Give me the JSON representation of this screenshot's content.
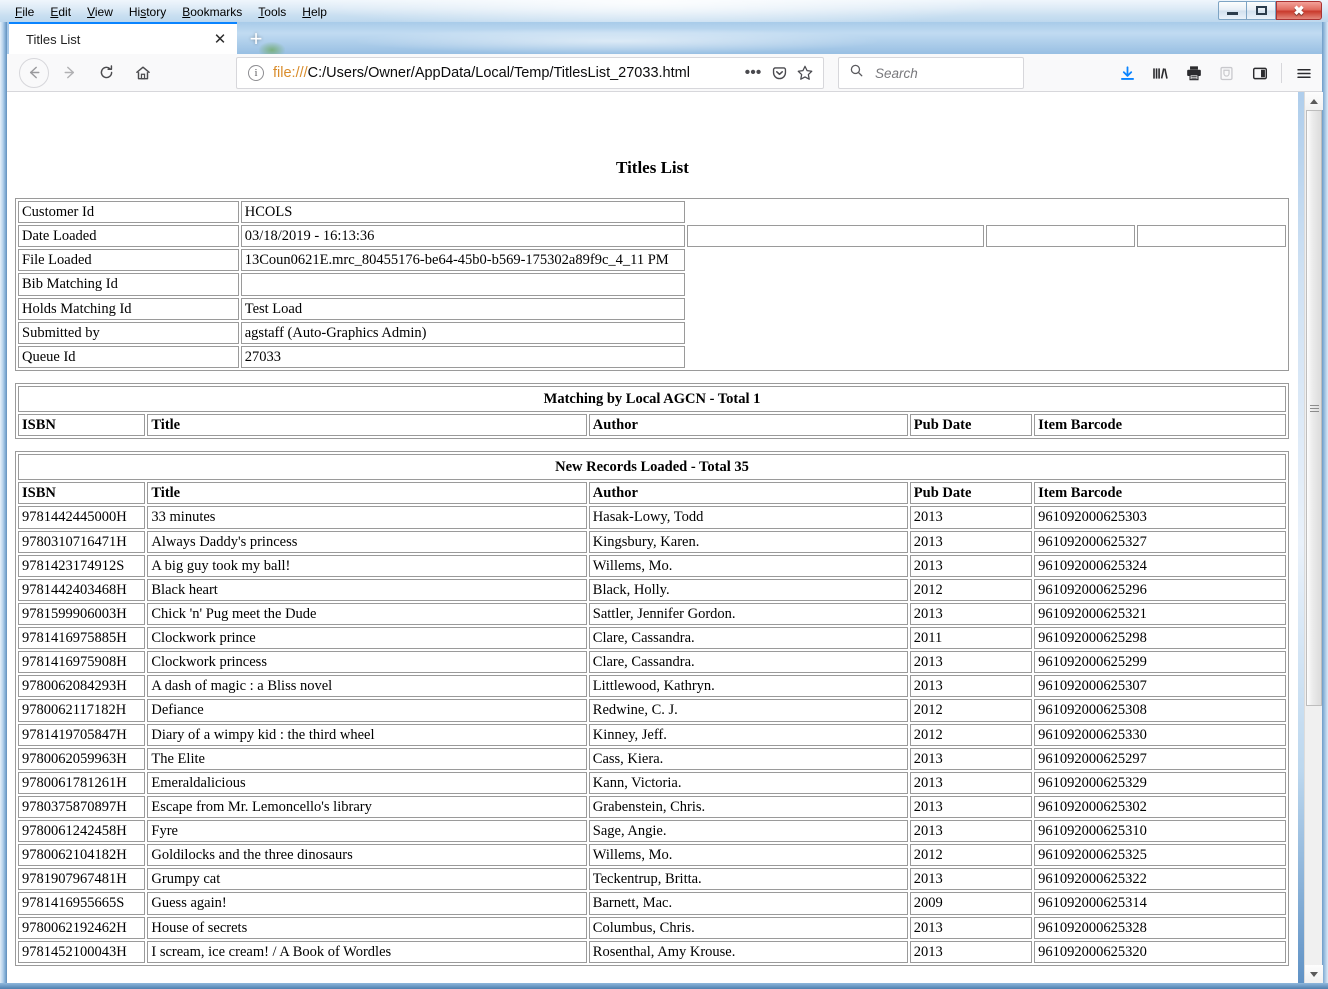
{
  "window": {
    "menu": [
      "File",
      "Edit",
      "View",
      "History",
      "Bookmarks",
      "Tools",
      "Help"
    ],
    "minimize_label": "–",
    "maximize_label": "",
    "close_label": "✕"
  },
  "browser": {
    "tab": {
      "title": "Titles List",
      "close_label": "✕"
    },
    "new_tab_label": "+",
    "url_scheme": "file:///",
    "url_rest": "C:/Users/Owner/AppData/Local/Temp/TitlesList_27033.html",
    "url_full": "file:///C:/Users/Owner/AppData/Local/Temp/TitlesList_27033.html",
    "info_icon_label": "i",
    "page_actions_label": "•••",
    "search": {
      "placeholder": "Search",
      "value": ""
    },
    "toolbar_icons": [
      "download-icon",
      "library-icon",
      "print-icon",
      "shield-icon",
      "sidebar-icon",
      "hamburger-menu-icon"
    ],
    "accent_color": "#0a84ff"
  },
  "page": {
    "title": "Titles List",
    "header": {
      "rows": [
        {
          "label": "Customer Id",
          "value": "HCOLS"
        },
        {
          "label": "Date Loaded",
          "value": "03/18/2019 - 16:13:36"
        },
        {
          "label": "File Loaded",
          "value": "13Coun0621E.mrc_80455176-be64-45b0-b569-175302a89f9c_4_11 PM"
        },
        {
          "label": "Bib Matching Id",
          "value": ""
        },
        {
          "label": "Holds Matching Id",
          "value": "Test Load"
        },
        {
          "label": "Submitted by",
          "value": "agstaff (Auto-Graphics Admin)"
        },
        {
          "label": "Queue Id",
          "value": "27033"
        }
      ],
      "extra_cells": [
        "",
        "",
        ""
      ]
    },
    "columns": [
      "ISBN",
      "Title",
      "Author",
      "Pub Date",
      "Item Barcode"
    ],
    "sections": [
      {
        "heading": "Matching by Local AGCN - Total 1",
        "rows": []
      },
      {
        "heading": "New Records Loaded - Total 35",
        "rows": [
          [
            "9781442445000H",
            "33 minutes",
            "Hasak-Lowy, Todd",
            "2013",
            "961092000625303"
          ],
          [
            "9780310716471H",
            "Always Daddy's princess",
            "Kingsbury, Karen.",
            "2013",
            "961092000625327"
          ],
          [
            "9781423174912S",
            "A big guy took my ball!",
            "Willems, Mo.",
            "2013",
            "961092000625324"
          ],
          [
            "9781442403468H",
            "Black heart",
            "Black, Holly.",
            "2012",
            "961092000625296"
          ],
          [
            "9781599906003H",
            "Chick 'n' Pug meet the Dude",
            "Sattler, Jennifer Gordon.",
            "2013",
            "961092000625321"
          ],
          [
            "9781416975885H",
            "Clockwork prince",
            "Clare, Cassandra.",
            "2011",
            "961092000625298"
          ],
          [
            "9781416975908H",
            "Clockwork princess",
            "Clare, Cassandra.",
            "2013",
            "961092000625299"
          ],
          [
            "9780062084293H",
            "A dash of magic : a Bliss novel",
            "Littlewood, Kathryn.",
            "2013",
            "961092000625307"
          ],
          [
            "9780062117182H",
            "Defiance",
            "Redwine, C. J.",
            "2012",
            "961092000625308"
          ],
          [
            "9781419705847H",
            "Diary of a wimpy kid : the third wheel",
            "Kinney, Jeff.",
            "2012",
            "961092000625330"
          ],
          [
            "9780062059963H",
            "The Elite",
            "Cass, Kiera.",
            "2013",
            "961092000625297"
          ],
          [
            "9780061781261H",
            "Emeraldalicious",
            "Kann, Victoria.",
            "2013",
            "961092000625329"
          ],
          [
            "9780375870897H",
            "Escape from Mr. Lemoncello's library",
            "Grabenstein, Chris.",
            "2013",
            "961092000625302"
          ],
          [
            "9780061242458H",
            "Fyre",
            "Sage, Angie.",
            "2013",
            "961092000625310"
          ],
          [
            "9780062104182H",
            "Goldilocks and the three dinosaurs",
            "Willems, Mo.",
            "2012",
            "961092000625325"
          ],
          [
            "9781907967481H",
            "Grumpy cat",
            "Teckentrup, Britta.",
            "2013",
            "961092000625322"
          ],
          [
            "9781416955665S",
            "Guess again!",
            "Barnett, Mac.",
            "2009",
            "961092000625314"
          ],
          [
            "9780062192462H",
            "House of secrets",
            "Columbus, Chris.",
            "2013",
            "961092000625328"
          ],
          [
            "9781452100043H",
            "I scream, ice cream! / A Book of Wordles",
            "Rosenthal, Amy Krouse.",
            "2013",
            "961092000625320"
          ]
        ]
      }
    ]
  }
}
